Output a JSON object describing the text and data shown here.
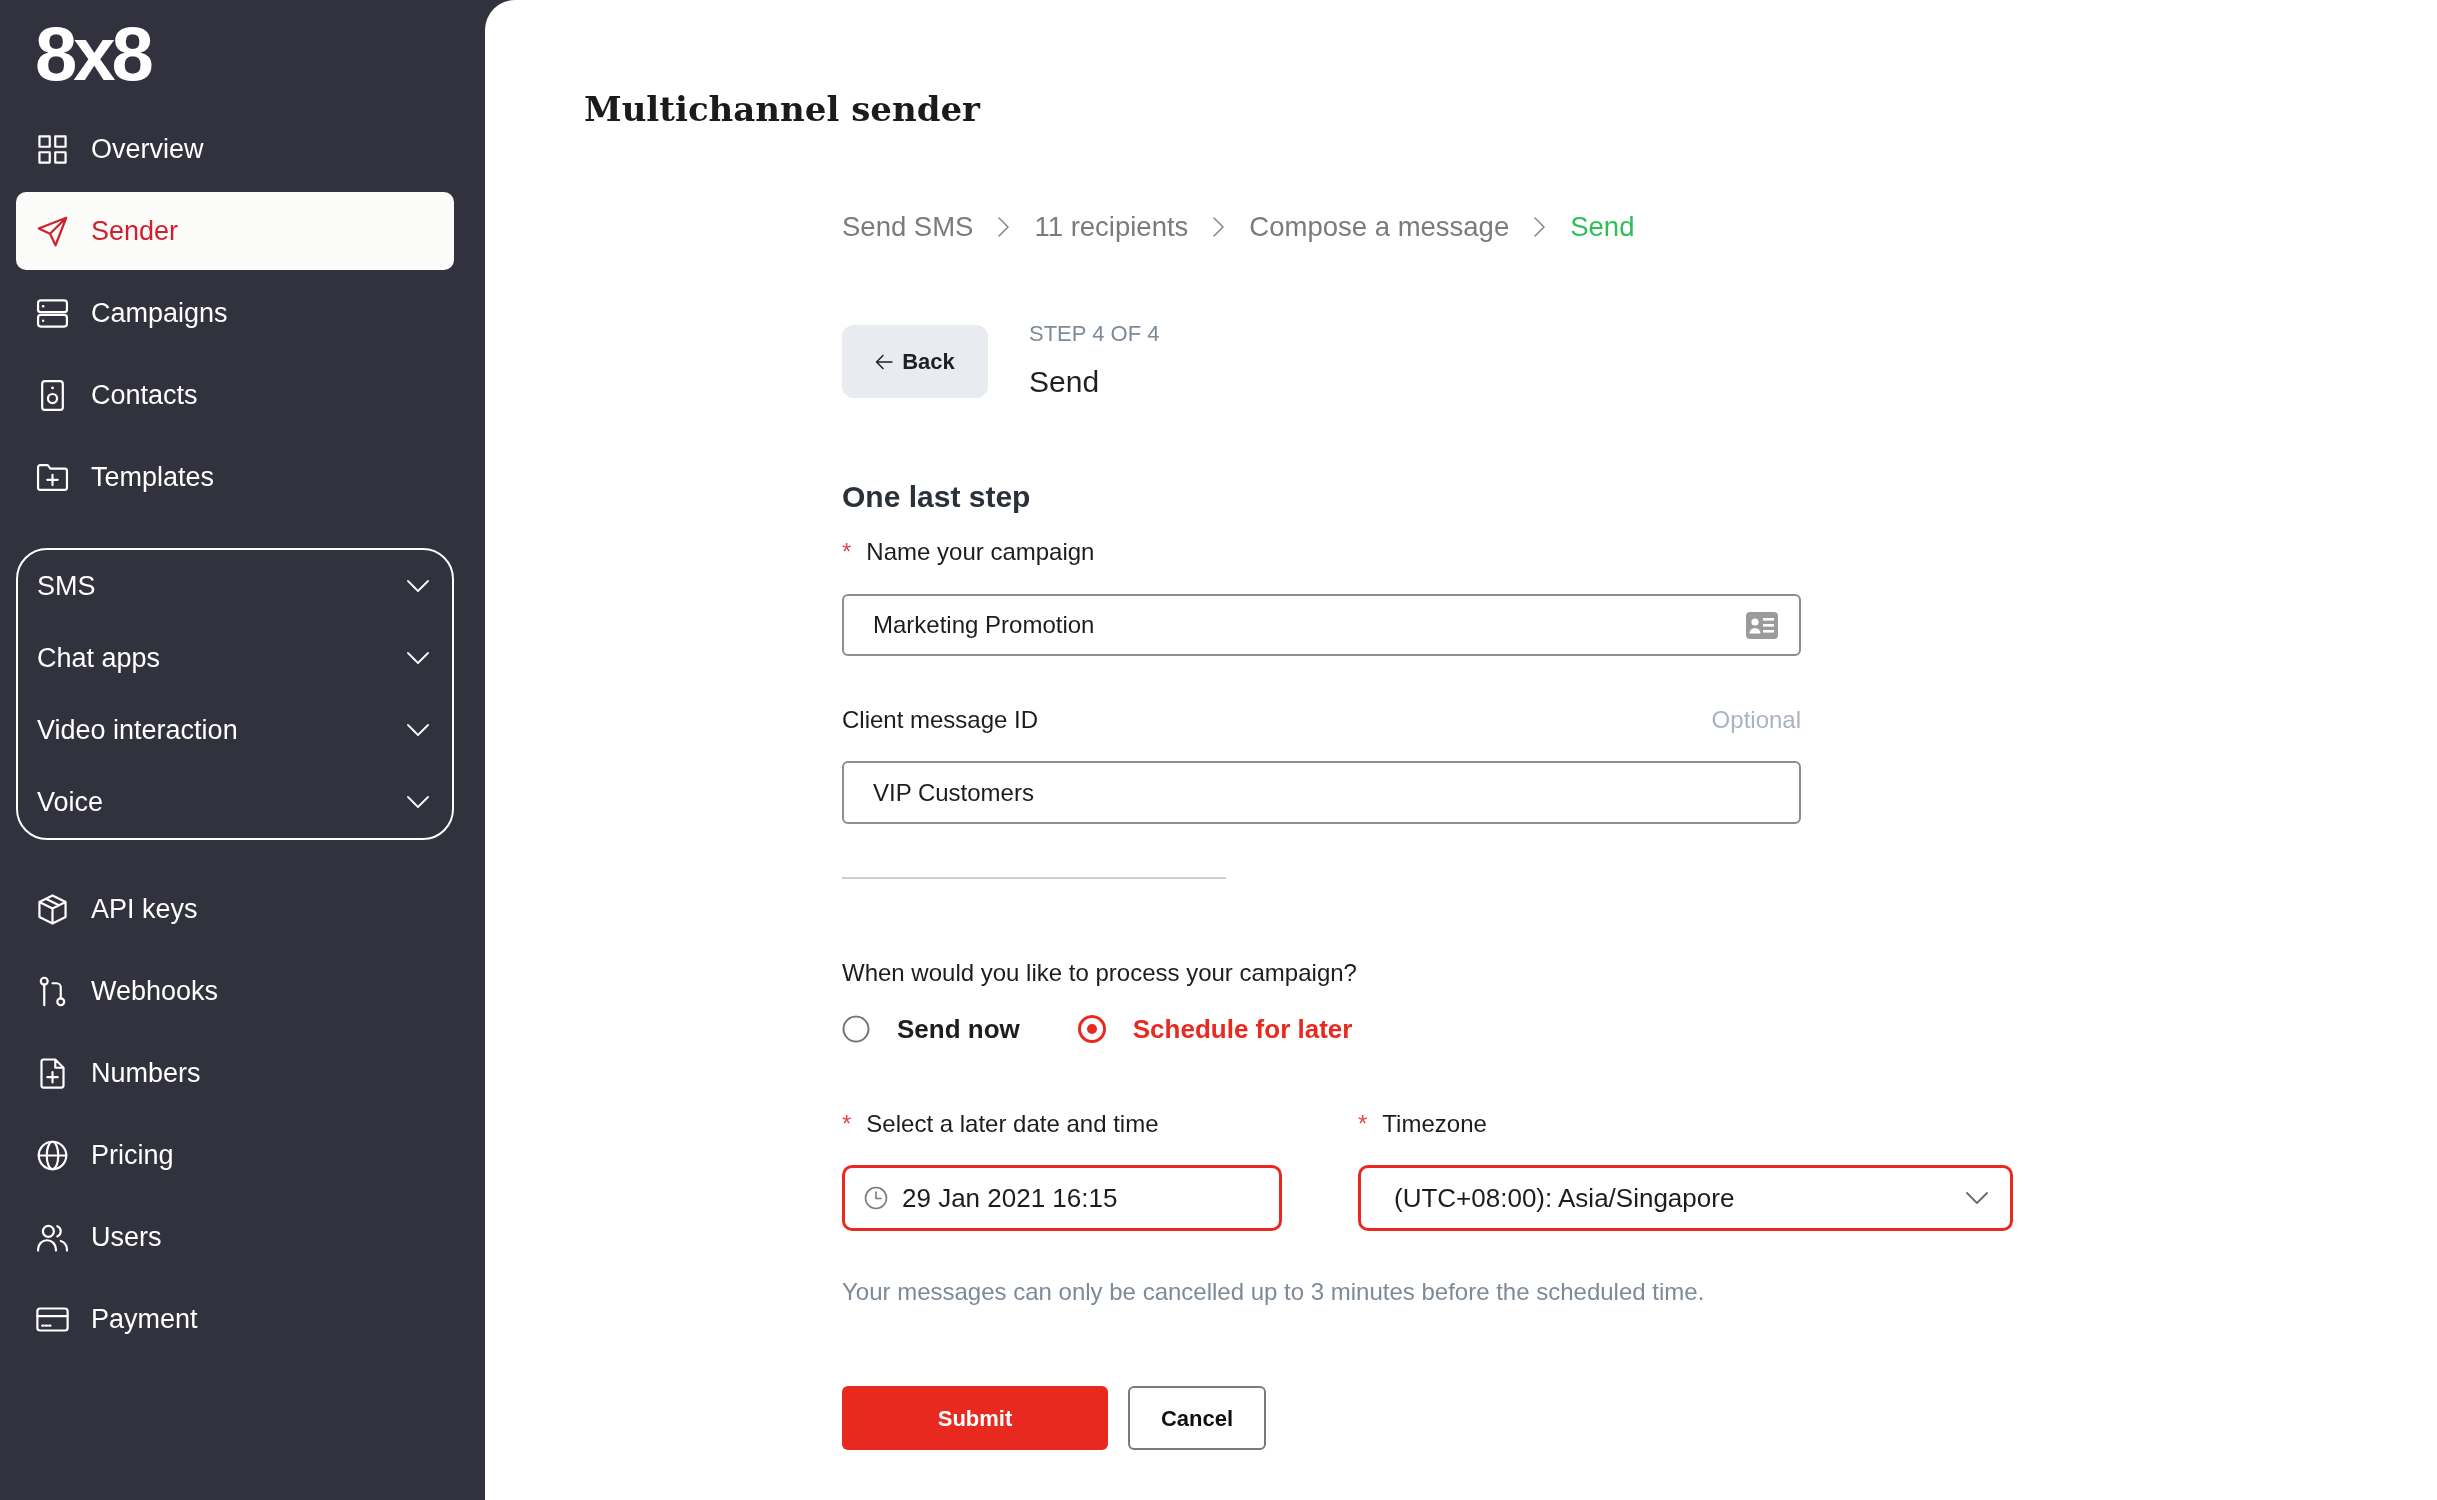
{
  "sidebar": {
    "logo": "8x8",
    "nav_items": [
      {
        "label": "Overview",
        "selected": false
      },
      {
        "label": "Sender",
        "selected": true
      },
      {
        "label": "Campaigns",
        "selected": false
      },
      {
        "label": "Contacts",
        "selected": false
      },
      {
        "label": "Templates",
        "selected": false
      }
    ],
    "groups": [
      {
        "label": "SMS",
        "expanded": false
      },
      {
        "label": "Chat apps",
        "expanded": false
      },
      {
        "label": "Video interaction",
        "expanded": false
      },
      {
        "label": "Voice",
        "expanded": false
      }
    ],
    "more_items": [
      {
        "label": "API keys",
        "selected": false
      },
      {
        "label": "Webhooks",
        "selected": false
      },
      {
        "label": "Numbers",
        "selected": false
      },
      {
        "label": "Pricing",
        "selected": false
      },
      {
        "label": "Users",
        "selected": false
      },
      {
        "label": "Payment",
        "selected": false
      }
    ]
  },
  "page": {
    "title": "Multichannel sender"
  },
  "breadcrumb": [
    {
      "label": "Send SMS",
      "current": false
    },
    {
      "label": "11 recipients",
      "current": false
    },
    {
      "label": "Compose a message",
      "current": false
    },
    {
      "label": "Send",
      "current": true
    }
  ],
  "step": {
    "back_button": "Back",
    "counter": "STEP 4 OF 4",
    "title": "Send"
  },
  "form": {
    "title": "One last step",
    "fields": [
      {
        "kind": "adorned",
        "required_mark": "*",
        "label": "Name your campaign",
        "value": "Marketing Promotion"
      },
      {
        "kind": "plain",
        "label": "Client message ID",
        "optional_label": "Optional",
        "value": "VIP Customers"
      }
    ]
  },
  "schedule": {
    "question": "When would you like to process your campaign?",
    "options": [
      {
        "label": "Send now",
        "selected": false
      },
      {
        "label": "Schedule for later",
        "selected": true
      }
    ],
    "date_time": {
      "required_mark": "*",
      "label": "Select a later date and time",
      "value": "29 Jan 2021 16:15",
      "highlighted": true
    },
    "timezone": {
      "required_mark": "*",
      "label": "Timezone",
      "value": "(UTC+08:00): Asia/Singapore",
      "highlighted": true
    },
    "note": "Your messages can only be cancelled up to 3 minutes before the scheduled time."
  },
  "actions": [
    {
      "label": "Submit",
      "kind": "primary"
    },
    {
      "label": "Cancel",
      "kind": "secondary"
    }
  ]
}
